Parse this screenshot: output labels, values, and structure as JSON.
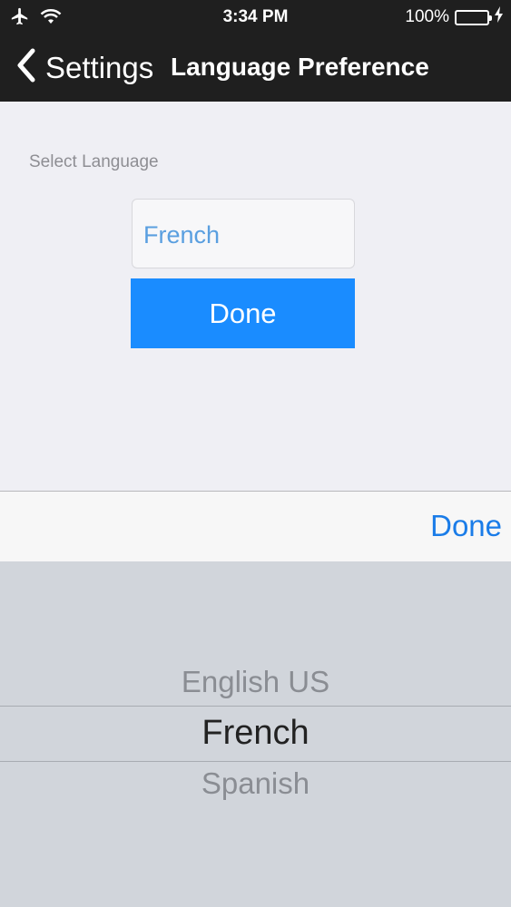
{
  "status_bar": {
    "time": "3:34 PM",
    "battery": "100%",
    "battery_level": 1.0,
    "icons": [
      "airplane-icon",
      "wifi-icon",
      "battery-icon",
      "charging-bolt-icon"
    ]
  },
  "nav": {
    "back_label": "Settings",
    "title": "Language Preference"
  },
  "form": {
    "section_label": "Select Language",
    "selected_value": "French",
    "done_label": "Done"
  },
  "picker": {
    "toolbar_done": "Done",
    "options": [
      "English US",
      "French",
      "Spanish"
    ],
    "selected_index": 1
  },
  "colors": {
    "accent": "#1a8cff",
    "nav_bg": "#1f1f1f",
    "picker_bg": "#d1d5db"
  }
}
